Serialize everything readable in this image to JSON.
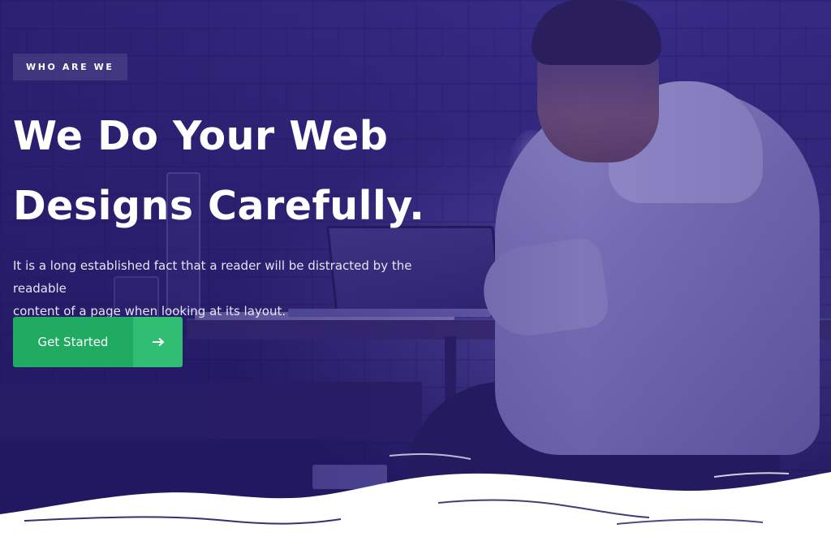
{
  "hero": {
    "badge": "WHO ARE WE",
    "title_line1": "We Do Your Web",
    "title_line2": "Designs Carefully.",
    "lead_line1": "It is a long established fact that a reader will be distracted by the readable",
    "lead_line2": "content of a page when looking at its layout.",
    "cta_label": "Get Started",
    "cta_icon": "arrow-right-icon"
  },
  "colors": {
    "overlay": "#2f2578",
    "cta_primary": "#21ab62",
    "cta_secondary": "#2fbe72",
    "wave": "#ffffff",
    "text": "#ffffff"
  }
}
